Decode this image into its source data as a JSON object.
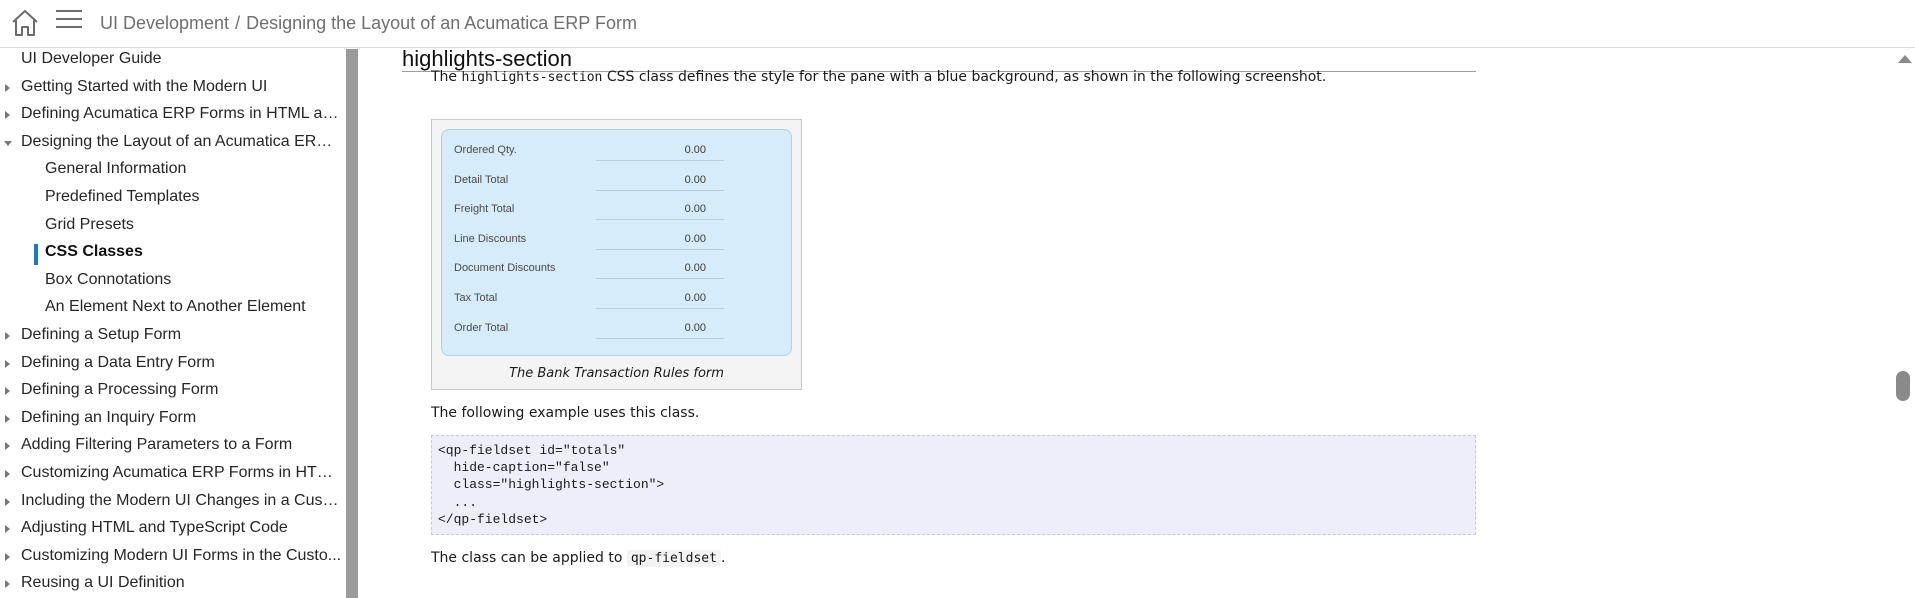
{
  "header": {
    "breadcrumb": [
      "UI Development",
      "Designing the Layout of an Acumatica ERP Form"
    ],
    "separator": "/"
  },
  "sidebar": {
    "active_color": "#1a7ac2",
    "items": [
      {
        "label": "UI Developer Guide",
        "level": 0,
        "arrow": "none"
      },
      {
        "label": "Getting Started with the Modern UI",
        "level": 0,
        "arrow": "right"
      },
      {
        "label": "Defining Acumatica ERP Forms in HTML an...",
        "level": 0,
        "arrow": "right"
      },
      {
        "label": "Designing the Layout of an Acumatica ERP ...",
        "level": 0,
        "arrow": "down"
      },
      {
        "label": "General Information",
        "level": 1,
        "arrow": "none"
      },
      {
        "label": "Predefined Templates",
        "level": 1,
        "arrow": "none"
      },
      {
        "label": "Grid Presets",
        "level": 1,
        "arrow": "none"
      },
      {
        "label": "CSS Classes",
        "level": 1,
        "arrow": "none",
        "active": true
      },
      {
        "label": "Box Connotations",
        "level": 1,
        "arrow": "none"
      },
      {
        "label": "An Element Next to Another Element",
        "level": 1,
        "arrow": "none"
      },
      {
        "label": "Defining a Setup Form",
        "level": 0,
        "arrow": "right"
      },
      {
        "label": "Defining a Data Entry Form",
        "level": 0,
        "arrow": "right"
      },
      {
        "label": "Defining a Processing Form",
        "level": 0,
        "arrow": "right"
      },
      {
        "label": "Defining an Inquiry Form",
        "level": 0,
        "arrow": "right"
      },
      {
        "label": "Adding Filtering Parameters to a Form",
        "level": 0,
        "arrow": "right"
      },
      {
        "label": "Customizing Acumatica ERP Forms in HTM...",
        "level": 0,
        "arrow": "right"
      },
      {
        "label": "Including the Modern UI Changes in a Custo...",
        "level": 0,
        "arrow": "right"
      },
      {
        "label": "Adjusting HTML and TypeScript Code",
        "level": 0,
        "arrow": "right"
      },
      {
        "label": "Customizing Modern UI Forms in the Custo...",
        "level": 0,
        "arrow": "right"
      },
      {
        "label": "Reusing a UI Definition",
        "level": 0,
        "arrow": "right"
      }
    ]
  },
  "main": {
    "section_title": "highlights-section",
    "intro": {
      "pre": "The ",
      "code": "highlights-section",
      "post": " CSS class defines the style for the pane with a blue background, as shown in the following screenshot."
    },
    "figure": {
      "panel_color": "#d6ecfa",
      "rows": [
        {
          "label": "Ordered Qty.",
          "value": "0.00"
        },
        {
          "label": "Detail Total",
          "value": "0.00"
        },
        {
          "label": "Freight Total",
          "value": "0.00"
        },
        {
          "label": "Line Discounts",
          "value": "0.00"
        },
        {
          "label": "Document Discounts",
          "value": "0.00"
        },
        {
          "label": "Tax Total",
          "value": "0.00"
        },
        {
          "label": "Order Total",
          "value": "0.00"
        }
      ],
      "caption": "The Bank Transaction Rules form"
    },
    "example_intro": "The following example uses this class.",
    "code_lines": [
      "<qp-fieldset id=\"totals\"",
      "  hide-caption=\"false\"",
      "  class=\"highlights-section\">",
      "  ...",
      "</qp-fieldset>"
    ],
    "applied": {
      "pre": "The class can be applied to ",
      "code": "qp-fieldset",
      "post": "."
    }
  }
}
